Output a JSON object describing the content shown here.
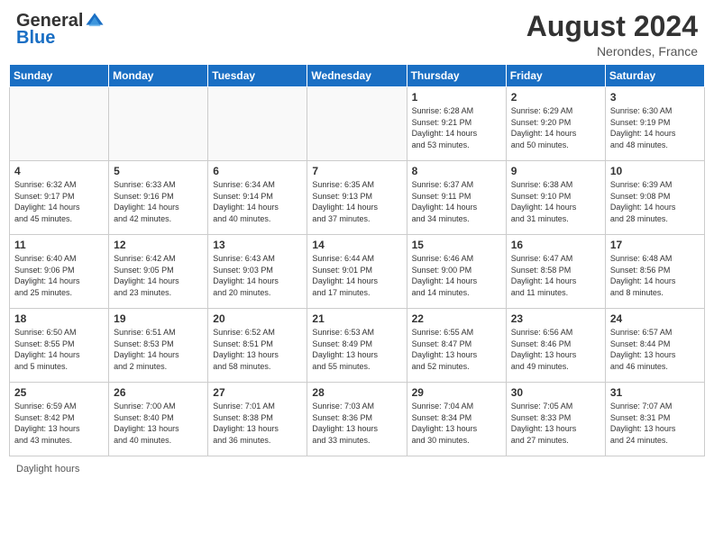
{
  "header": {
    "logo_general": "General",
    "logo_blue": "Blue",
    "month_year": "August 2024",
    "location": "Nerondes, France"
  },
  "days_of_week": [
    "Sunday",
    "Monday",
    "Tuesday",
    "Wednesday",
    "Thursday",
    "Friday",
    "Saturday"
  ],
  "footer": {
    "daylight_hours": "Daylight hours"
  },
  "weeks": [
    {
      "days": [
        {
          "num": "",
          "info": ""
        },
        {
          "num": "",
          "info": ""
        },
        {
          "num": "",
          "info": ""
        },
        {
          "num": "",
          "info": ""
        },
        {
          "num": "1",
          "info": "Sunrise: 6:28 AM\nSunset: 9:21 PM\nDaylight: 14 hours\nand 53 minutes."
        },
        {
          "num": "2",
          "info": "Sunrise: 6:29 AM\nSunset: 9:20 PM\nDaylight: 14 hours\nand 50 minutes."
        },
        {
          "num": "3",
          "info": "Sunrise: 6:30 AM\nSunset: 9:19 PM\nDaylight: 14 hours\nand 48 minutes."
        }
      ]
    },
    {
      "days": [
        {
          "num": "4",
          "info": "Sunrise: 6:32 AM\nSunset: 9:17 PM\nDaylight: 14 hours\nand 45 minutes."
        },
        {
          "num": "5",
          "info": "Sunrise: 6:33 AM\nSunset: 9:16 PM\nDaylight: 14 hours\nand 42 minutes."
        },
        {
          "num": "6",
          "info": "Sunrise: 6:34 AM\nSunset: 9:14 PM\nDaylight: 14 hours\nand 40 minutes."
        },
        {
          "num": "7",
          "info": "Sunrise: 6:35 AM\nSunset: 9:13 PM\nDaylight: 14 hours\nand 37 minutes."
        },
        {
          "num": "8",
          "info": "Sunrise: 6:37 AM\nSunset: 9:11 PM\nDaylight: 14 hours\nand 34 minutes."
        },
        {
          "num": "9",
          "info": "Sunrise: 6:38 AM\nSunset: 9:10 PM\nDaylight: 14 hours\nand 31 minutes."
        },
        {
          "num": "10",
          "info": "Sunrise: 6:39 AM\nSunset: 9:08 PM\nDaylight: 14 hours\nand 28 minutes."
        }
      ]
    },
    {
      "days": [
        {
          "num": "11",
          "info": "Sunrise: 6:40 AM\nSunset: 9:06 PM\nDaylight: 14 hours\nand 25 minutes."
        },
        {
          "num": "12",
          "info": "Sunrise: 6:42 AM\nSunset: 9:05 PM\nDaylight: 14 hours\nand 23 minutes."
        },
        {
          "num": "13",
          "info": "Sunrise: 6:43 AM\nSunset: 9:03 PM\nDaylight: 14 hours\nand 20 minutes."
        },
        {
          "num": "14",
          "info": "Sunrise: 6:44 AM\nSunset: 9:01 PM\nDaylight: 14 hours\nand 17 minutes."
        },
        {
          "num": "15",
          "info": "Sunrise: 6:46 AM\nSunset: 9:00 PM\nDaylight: 14 hours\nand 14 minutes."
        },
        {
          "num": "16",
          "info": "Sunrise: 6:47 AM\nSunset: 8:58 PM\nDaylight: 14 hours\nand 11 minutes."
        },
        {
          "num": "17",
          "info": "Sunrise: 6:48 AM\nSunset: 8:56 PM\nDaylight: 14 hours\nand 8 minutes."
        }
      ]
    },
    {
      "days": [
        {
          "num": "18",
          "info": "Sunrise: 6:50 AM\nSunset: 8:55 PM\nDaylight: 14 hours\nand 5 minutes."
        },
        {
          "num": "19",
          "info": "Sunrise: 6:51 AM\nSunset: 8:53 PM\nDaylight: 14 hours\nand 2 minutes."
        },
        {
          "num": "20",
          "info": "Sunrise: 6:52 AM\nSunset: 8:51 PM\nDaylight: 13 hours\nand 58 minutes."
        },
        {
          "num": "21",
          "info": "Sunrise: 6:53 AM\nSunset: 8:49 PM\nDaylight: 13 hours\nand 55 minutes."
        },
        {
          "num": "22",
          "info": "Sunrise: 6:55 AM\nSunset: 8:47 PM\nDaylight: 13 hours\nand 52 minutes."
        },
        {
          "num": "23",
          "info": "Sunrise: 6:56 AM\nSunset: 8:46 PM\nDaylight: 13 hours\nand 49 minutes."
        },
        {
          "num": "24",
          "info": "Sunrise: 6:57 AM\nSunset: 8:44 PM\nDaylight: 13 hours\nand 46 minutes."
        }
      ]
    },
    {
      "days": [
        {
          "num": "25",
          "info": "Sunrise: 6:59 AM\nSunset: 8:42 PM\nDaylight: 13 hours\nand 43 minutes."
        },
        {
          "num": "26",
          "info": "Sunrise: 7:00 AM\nSunset: 8:40 PM\nDaylight: 13 hours\nand 40 minutes."
        },
        {
          "num": "27",
          "info": "Sunrise: 7:01 AM\nSunset: 8:38 PM\nDaylight: 13 hours\nand 36 minutes."
        },
        {
          "num": "28",
          "info": "Sunrise: 7:03 AM\nSunset: 8:36 PM\nDaylight: 13 hours\nand 33 minutes."
        },
        {
          "num": "29",
          "info": "Sunrise: 7:04 AM\nSunset: 8:34 PM\nDaylight: 13 hours\nand 30 minutes."
        },
        {
          "num": "30",
          "info": "Sunrise: 7:05 AM\nSunset: 8:33 PM\nDaylight: 13 hours\nand 27 minutes."
        },
        {
          "num": "31",
          "info": "Sunrise: 7:07 AM\nSunset: 8:31 PM\nDaylight: 13 hours\nand 24 minutes."
        }
      ]
    }
  ]
}
